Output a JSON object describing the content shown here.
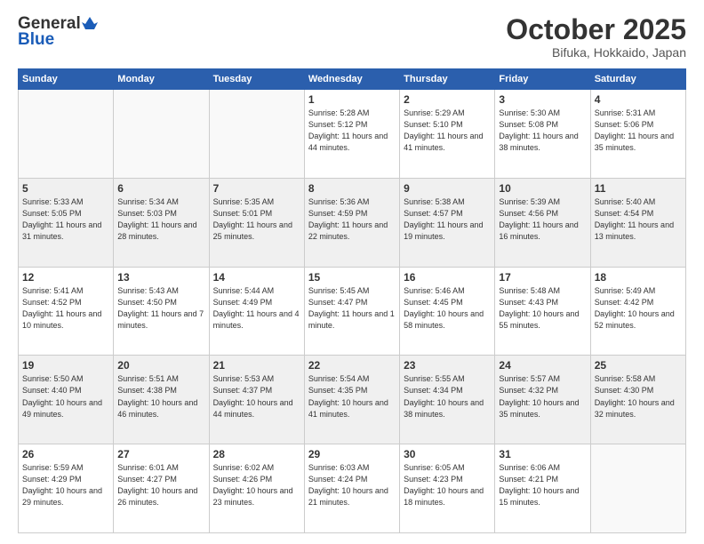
{
  "header": {
    "logo_general": "General",
    "logo_blue": "Blue",
    "month_title": "October 2025",
    "location": "Bifuka, Hokkaido, Japan"
  },
  "weekdays": [
    "Sunday",
    "Monday",
    "Tuesday",
    "Wednesday",
    "Thursday",
    "Friday",
    "Saturday"
  ],
  "weeks": [
    [
      {
        "day": "",
        "info": ""
      },
      {
        "day": "",
        "info": ""
      },
      {
        "day": "",
        "info": ""
      },
      {
        "day": "1",
        "info": "Sunrise: 5:28 AM\nSunset: 5:12 PM\nDaylight: 11 hours\nand 44 minutes."
      },
      {
        "day": "2",
        "info": "Sunrise: 5:29 AM\nSunset: 5:10 PM\nDaylight: 11 hours\nand 41 minutes."
      },
      {
        "day": "3",
        "info": "Sunrise: 5:30 AM\nSunset: 5:08 PM\nDaylight: 11 hours\nand 38 minutes."
      },
      {
        "day": "4",
        "info": "Sunrise: 5:31 AM\nSunset: 5:06 PM\nDaylight: 11 hours\nand 35 minutes."
      }
    ],
    [
      {
        "day": "5",
        "info": "Sunrise: 5:33 AM\nSunset: 5:05 PM\nDaylight: 11 hours\nand 31 minutes."
      },
      {
        "day": "6",
        "info": "Sunrise: 5:34 AM\nSunset: 5:03 PM\nDaylight: 11 hours\nand 28 minutes."
      },
      {
        "day": "7",
        "info": "Sunrise: 5:35 AM\nSunset: 5:01 PM\nDaylight: 11 hours\nand 25 minutes."
      },
      {
        "day": "8",
        "info": "Sunrise: 5:36 AM\nSunset: 4:59 PM\nDaylight: 11 hours\nand 22 minutes."
      },
      {
        "day": "9",
        "info": "Sunrise: 5:38 AM\nSunset: 4:57 PM\nDaylight: 11 hours\nand 19 minutes."
      },
      {
        "day": "10",
        "info": "Sunrise: 5:39 AM\nSunset: 4:56 PM\nDaylight: 11 hours\nand 16 minutes."
      },
      {
        "day": "11",
        "info": "Sunrise: 5:40 AM\nSunset: 4:54 PM\nDaylight: 11 hours\nand 13 minutes."
      }
    ],
    [
      {
        "day": "12",
        "info": "Sunrise: 5:41 AM\nSunset: 4:52 PM\nDaylight: 11 hours\nand 10 minutes."
      },
      {
        "day": "13",
        "info": "Sunrise: 5:43 AM\nSunset: 4:50 PM\nDaylight: 11 hours\nand 7 minutes."
      },
      {
        "day": "14",
        "info": "Sunrise: 5:44 AM\nSunset: 4:49 PM\nDaylight: 11 hours\nand 4 minutes."
      },
      {
        "day": "15",
        "info": "Sunrise: 5:45 AM\nSunset: 4:47 PM\nDaylight: 11 hours\nand 1 minute."
      },
      {
        "day": "16",
        "info": "Sunrise: 5:46 AM\nSunset: 4:45 PM\nDaylight: 10 hours\nand 58 minutes."
      },
      {
        "day": "17",
        "info": "Sunrise: 5:48 AM\nSunset: 4:43 PM\nDaylight: 10 hours\nand 55 minutes."
      },
      {
        "day": "18",
        "info": "Sunrise: 5:49 AM\nSunset: 4:42 PM\nDaylight: 10 hours\nand 52 minutes."
      }
    ],
    [
      {
        "day": "19",
        "info": "Sunrise: 5:50 AM\nSunset: 4:40 PM\nDaylight: 10 hours\nand 49 minutes."
      },
      {
        "day": "20",
        "info": "Sunrise: 5:51 AM\nSunset: 4:38 PM\nDaylight: 10 hours\nand 46 minutes."
      },
      {
        "day": "21",
        "info": "Sunrise: 5:53 AM\nSunset: 4:37 PM\nDaylight: 10 hours\nand 44 minutes."
      },
      {
        "day": "22",
        "info": "Sunrise: 5:54 AM\nSunset: 4:35 PM\nDaylight: 10 hours\nand 41 minutes."
      },
      {
        "day": "23",
        "info": "Sunrise: 5:55 AM\nSunset: 4:34 PM\nDaylight: 10 hours\nand 38 minutes."
      },
      {
        "day": "24",
        "info": "Sunrise: 5:57 AM\nSunset: 4:32 PM\nDaylight: 10 hours\nand 35 minutes."
      },
      {
        "day": "25",
        "info": "Sunrise: 5:58 AM\nSunset: 4:30 PM\nDaylight: 10 hours\nand 32 minutes."
      }
    ],
    [
      {
        "day": "26",
        "info": "Sunrise: 5:59 AM\nSunset: 4:29 PM\nDaylight: 10 hours\nand 29 minutes."
      },
      {
        "day": "27",
        "info": "Sunrise: 6:01 AM\nSunset: 4:27 PM\nDaylight: 10 hours\nand 26 minutes."
      },
      {
        "day": "28",
        "info": "Sunrise: 6:02 AM\nSunset: 4:26 PM\nDaylight: 10 hours\nand 23 minutes."
      },
      {
        "day": "29",
        "info": "Sunrise: 6:03 AM\nSunset: 4:24 PM\nDaylight: 10 hours\nand 21 minutes."
      },
      {
        "day": "30",
        "info": "Sunrise: 6:05 AM\nSunset: 4:23 PM\nDaylight: 10 hours\nand 18 minutes."
      },
      {
        "day": "31",
        "info": "Sunrise: 6:06 AM\nSunset: 4:21 PM\nDaylight: 10 hours\nand 15 minutes."
      },
      {
        "day": "",
        "info": ""
      }
    ]
  ]
}
